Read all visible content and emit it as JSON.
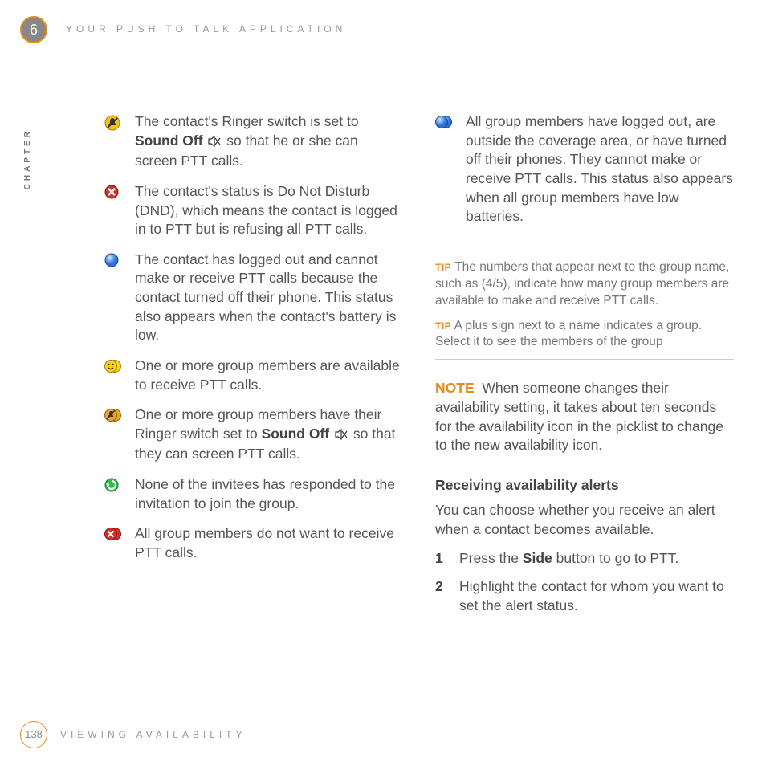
{
  "header": {
    "chapter_number": "6",
    "header_title": "YOUR PUSH TO TALK APPLICATION",
    "chapter_label": "CHAPTER"
  },
  "left_items": {
    "i0": {
      "pre": "The contact's Ringer switch is set to ",
      "bold": "Sound Off",
      "post": " so that he or she can screen PTT calls."
    },
    "i1": {
      "text": "The contact's status is Do Not Disturb (DND), which means the contact is logged in to PTT but is refusing all PTT calls."
    },
    "i2": {
      "text": "The contact has logged out and cannot make or receive PTT calls because the contact turned off their phone. This status also appears when the contact's battery is low."
    },
    "i3": {
      "text": "One or more group members are available to receive PTT calls."
    },
    "i4": {
      "pre": "One or more group members have their Ringer switch set to ",
      "bold": "Sound Off",
      "post": " so that they can screen PTT calls."
    },
    "i5": {
      "text": "None of the invitees has responded to the invitation to join the group."
    },
    "i6": {
      "text": "All group members do not want to receive PTT calls."
    }
  },
  "right_items": {
    "r0": {
      "text": "All group members have logged out, are outside the coverage area, or have turned off their phones. They cannot make or receive PTT calls. This status also appears when all group members have low batteries."
    }
  },
  "tips": {
    "label": "TIP",
    "t0": "The numbers that appear next to the group name, such as (4/5), indicate how many group members are available to make and receive PTT calls.",
    "t1": "A plus sign next to a name indicates a group. Select it to see the members of the group"
  },
  "note": {
    "label": "NOTE",
    "text": "When someone changes their availability setting, it takes about ten seconds for the availability icon in the picklist to change to the new availability icon."
  },
  "section": {
    "heading": "Receiving availability alerts",
    "intro": "You can choose whether you receive an alert when a contact becomes available.",
    "steps": {
      "s1": {
        "num": "1",
        "pre": "Press the ",
        "bold": "Side",
        "post": " button to go to PTT."
      },
      "s2": {
        "num": "2",
        "text": "Highlight the contact for whom you want to set the alert status."
      }
    }
  },
  "footer": {
    "page": "138",
    "title": "VIEWING AVAILABILITY"
  }
}
